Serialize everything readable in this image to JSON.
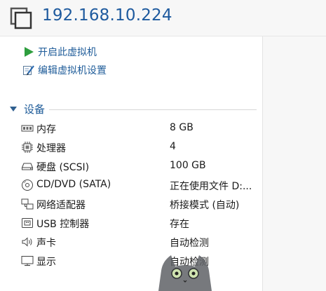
{
  "vm": {
    "title": "192.168.10.224"
  },
  "actions": [
    {
      "label": "开启此虚拟机",
      "icon": "play-icon"
    },
    {
      "label": "编辑虚拟机设置",
      "icon": "edit-settings-icon"
    }
  ],
  "devices": {
    "title": "设备",
    "items": [
      {
        "name": "内存",
        "value": "8 GB",
        "icon": "memory-icon"
      },
      {
        "name": "处理器",
        "value": "4",
        "icon": "processor-icon"
      },
      {
        "name": "硬盘 (SCSI)",
        "value": "100 GB",
        "icon": "hard-disk-icon"
      },
      {
        "name": "CD/DVD (SATA)",
        "value": "正在使用文件 D:...",
        "icon": "cd-dvd-icon"
      },
      {
        "name": "网络适配器",
        "value": "桥接模式 (自动)",
        "icon": "network-adapter-icon"
      },
      {
        "name": "USB 控制器",
        "value": "存在",
        "icon": "usb-icon"
      },
      {
        "name": "声卡",
        "value": "自动检测",
        "icon": "speaker-icon"
      },
      {
        "name": "显示",
        "value": "自动检测",
        "icon": "display-icon"
      }
    ]
  },
  "colors": {
    "accent": "#1e5a9e",
    "play": "#2e9e3e"
  }
}
